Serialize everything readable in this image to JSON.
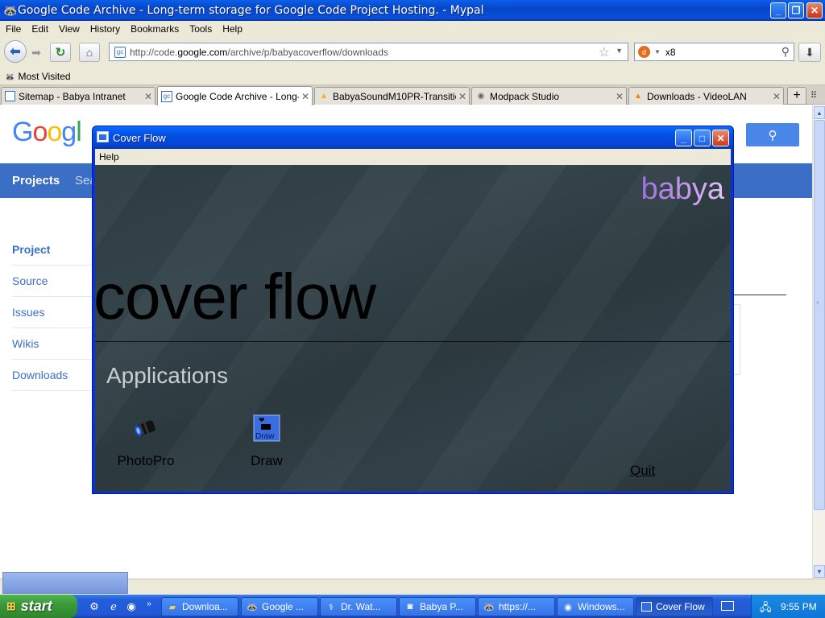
{
  "browser": {
    "window_title": "Google Code Archive - Long-term storage for Google Code Project Hosting. - Mypal",
    "menu": [
      "File",
      "Edit",
      "View",
      "History",
      "Bookmarks",
      "Tools",
      "Help"
    ],
    "url_prefix": "http://code.",
    "url_domain": "google.com",
    "url_path": "/archive/p/babyacoverflow/downloads",
    "search_value": "x8",
    "bookmark": "Most Visited",
    "tabs": [
      {
        "label": "Sitemap - Babya Intranet",
        "icon": "page-icon"
      },
      {
        "label": "Google Code Archive - Long-t...",
        "icon": "gc-icon"
      },
      {
        "label": "BabyaSoundM10PR-Transitio...",
        "icon": "drive-icon"
      },
      {
        "label": "Modpack Studio",
        "icon": "globe-icon"
      },
      {
        "label": "Downloads - VideoLAN",
        "icon": "vlc-icon"
      }
    ]
  },
  "page": {
    "logo": [
      "G",
      "o",
      "o",
      "g",
      "l"
    ],
    "nav_projects": "Projects",
    "nav_search_partial": "Sea",
    "sidebar": [
      "Project",
      "Source",
      "Issues",
      "Wikis",
      "Downloads"
    ]
  },
  "coverflow": {
    "title": "Cover Flow",
    "menu_help": "Help",
    "brand": "babya",
    "heading": "cover flow",
    "section": "Applications",
    "apps": [
      {
        "label": "PhotoPro",
        "icon": "camera-lens-icon"
      },
      {
        "label": "Draw",
        "icon": "draw-icon",
        "icon_text": "Draw"
      }
    ],
    "quit": "Quit"
  },
  "taskbar": {
    "start": "start",
    "buttons": [
      {
        "label": "Downloa...",
        "icon": "folder-icon"
      },
      {
        "label": "Google ...",
        "icon": "mypal-icon"
      },
      {
        "label": "Dr. Wat...",
        "icon": "drwatson-icon"
      },
      {
        "label": "Babya P...",
        "icon": "camera-icon"
      },
      {
        "label": "https://...",
        "icon": "mypal-icon"
      },
      {
        "label": "Windows...",
        "icon": "mediaplayer-icon"
      },
      {
        "label": "Cover Flow",
        "icon": "window-icon"
      }
    ],
    "clock": "9:55 PM"
  }
}
